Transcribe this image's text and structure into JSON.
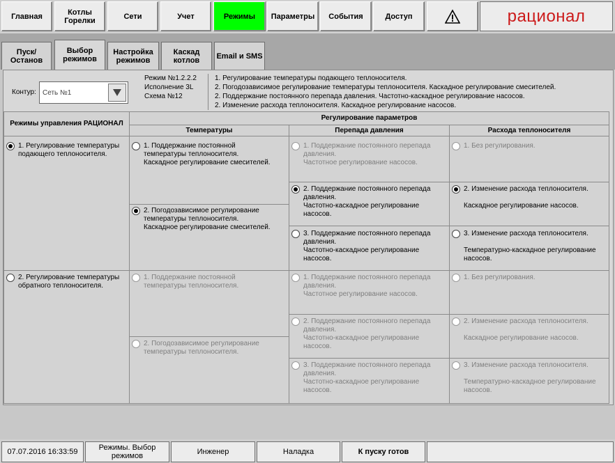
{
  "nav": {
    "items": [
      {
        "label": "Главная"
      },
      {
        "label": "Котлы\nГорелки"
      },
      {
        "label": "Сети"
      },
      {
        "label": "Учет"
      },
      {
        "label": "Режимы"
      },
      {
        "label": "Параметры"
      },
      {
        "label": "События"
      },
      {
        "label": "Доступ"
      }
    ],
    "warning_icon": "warning-triangle-icon",
    "logo": "рационал",
    "active_color": "#00ff00",
    "logo_color": "#cc1a1a"
  },
  "tabs": [
    {
      "label": "Пуск/Останов"
    },
    {
      "label": "Выбор\nрежимов"
    },
    {
      "label": "Настройка\nрежимов"
    },
    {
      "label": "Каскад\nкотлов"
    },
    {
      "label": "Email и SMS"
    }
  ],
  "panel": {
    "contour_label": "Контур:",
    "contour_value": "Сеть №1",
    "mode": "Режим №1.2.2.2",
    "execution": "Исполнение 3L",
    "scheme": "Схема №12",
    "desc": [
      "1. Регулирование температуры подающего теплоносителя.",
      "2. Погодозависимое регулирование температуры теплоносителя. Каскадное регулирование смесителей.",
      "2. Поддержание постоянного перепада давления. Частотно-каскадное регулирование насосов.",
      "2. Изменение расхода теплоносителя. Каскадное регулирование насосов."
    ]
  },
  "table": {
    "col_modes": "Режимы управления РАЦИОНАЛ",
    "col_params": "Регулирование параметров",
    "col_temp": "Температуры",
    "col_press": "Перепада давления",
    "col_flow": "Расхода теплоносителя",
    "modes": [
      {
        "text": "1. Регулирование температуры\nподающего теплоносителя."
      },
      {
        "text": "2. Регулирование температуры\nобратного теплоносителя."
      }
    ],
    "temp": [
      {
        "text": "1. Поддержание постоянной\nтемпературы теплоносителя.\nКаскадное регулирование смесителей."
      },
      {
        "text": "2. Погодозависимое регулирование\nтемпературы теплоносителя.\nКаскадное регулирование смесителей."
      },
      {
        "text": "1. Поддержание постоянной\nтемпературы теплоносителя."
      },
      {
        "text": "2. Погодозависимое регулирование\nтемпературы теплоносителя."
      }
    ],
    "press": [
      {
        "text": "1. Поддержание постоянного перепада\nдавления.\nЧастотное регулирование насосов."
      },
      {
        "text": "2. Поддержание постоянного перепада\nдавления.\nЧастотно-каскадное регулирование\nнасосов."
      },
      {
        "text": "3. Поддержание постоянного перепада\nдавления.\nЧастотно-каскадное регулирование\nнасосов."
      },
      {
        "text": "1. Поддержание постоянного перепада\nдавления.\nЧастотное регулирование насосов."
      },
      {
        "text": "2. Поддержание постоянного перепада\nдавления.\nЧастотно-каскадное регулирование\nнасосов."
      },
      {
        "text": "3. Поддержание постоянного перепада\nдавления.\nЧастотно-каскадное регулирование\nнасосов."
      }
    ],
    "flow": [
      {
        "text": "1. Без регулирования."
      },
      {
        "text": "2. Изменение расхода теплоносителя.\n\nКаскадное регулирование насосов."
      },
      {
        "text": "3. Изменение расхода теплоносителя.\n\nТемпературно-каскадное регулирование\nнасосов."
      },
      {
        "text": "1. Без регулирования."
      },
      {
        "text": "2. Изменение расхода теплоносителя.\n\nКаскадное регулирование насосов."
      },
      {
        "text": "3. Изменение расхода теплоносителя.\n\nТемпературно-каскадное регулирование\nнасосов."
      }
    ]
  },
  "status": {
    "datetime": "07.07.2016 16:33:59",
    "screen": "Режимы. Выбор\nрежимов",
    "user": "Инженер",
    "mode": "Наладка",
    "state": "К пуску готов"
  }
}
